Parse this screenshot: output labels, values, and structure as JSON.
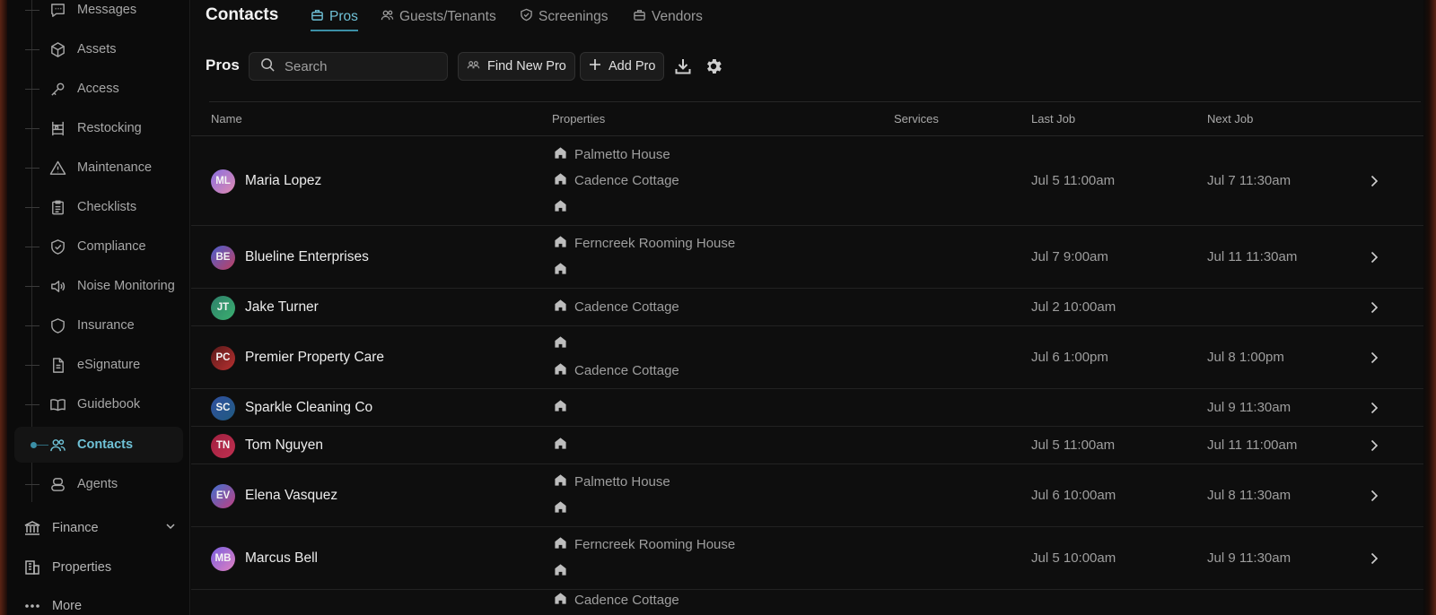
{
  "sidebar": {
    "items": [
      {
        "label": "Messages",
        "icon": "message-icon"
      },
      {
        "label": "Assets",
        "icon": "cube-icon"
      },
      {
        "label": "Access",
        "icon": "key-icon"
      },
      {
        "label": "Restocking",
        "icon": "shelf-icon"
      },
      {
        "label": "Maintenance",
        "icon": "warning-icon"
      },
      {
        "label": "Checklists",
        "icon": "clipboard-icon"
      },
      {
        "label": "Compliance",
        "icon": "shield-check-icon"
      },
      {
        "label": "Noise Monitoring",
        "icon": "speaker-icon"
      },
      {
        "label": "Insurance",
        "icon": "shield-icon"
      },
      {
        "label": "eSignature",
        "icon": "document-icon"
      },
      {
        "label": "Guidebook",
        "icon": "book-icon"
      },
      {
        "label": "Contacts",
        "icon": "users-icon",
        "active": true
      },
      {
        "label": "Agents",
        "icon": "agent-icon"
      }
    ],
    "finance": "Finance",
    "properties": "Properties",
    "more": "More"
  },
  "header": {
    "title": "Contacts",
    "tabs": [
      "Pros",
      "Guests/Tenants",
      "Screenings",
      "Vendors"
    ]
  },
  "toolbar": {
    "section_title": "Pros",
    "search_placeholder": "Search",
    "find_new_pro": "Find New Pro",
    "add_pro": "Add Pro"
  },
  "table": {
    "columns": [
      "Name",
      "Properties",
      "Services",
      "Last Job",
      "Next Job"
    ],
    "rows": [
      {
        "initials": "ML",
        "name": "Maria Lopez",
        "properties": [
          "Palmetto House",
          "Cadence Cottage",
          ""
        ],
        "last_job": "Jul 5 11:00am",
        "next_job": "Jul 7 11:30am"
      },
      {
        "initials": "BE",
        "name": "Blueline Enterprises",
        "properties": [
          "Ferncreek Rooming House",
          ""
        ],
        "last_job": "Jul 7 9:00am",
        "next_job": "Jul 11 11:30am"
      },
      {
        "initials": "JT",
        "name": "Jake Turner",
        "properties": [
          "Cadence Cottage"
        ],
        "last_job": "Jul 2 10:00am",
        "next_job": ""
      },
      {
        "initials": "PC",
        "name": "Premier Property Care",
        "properties": [
          "",
          "Cadence Cottage"
        ],
        "last_job": "Jul 6 1:00pm",
        "next_job": "Jul 8 1:00pm"
      },
      {
        "initials": "SC",
        "name": "Sparkle Cleaning Co",
        "properties": [
          ""
        ],
        "last_job": "",
        "next_job": "Jul 9 11:30am"
      },
      {
        "initials": "TN",
        "name": "Tom Nguyen",
        "properties": [
          ""
        ],
        "last_job": "Jul 5 11:00am",
        "next_job": "Jul 11 11:00am"
      },
      {
        "initials": "EV",
        "name": "Elena Vasquez",
        "properties": [
          "Palmetto House",
          ""
        ],
        "last_job": "Jul 6 10:00am",
        "next_job": "Jul 8 11:30am"
      },
      {
        "initials": "MB",
        "name": "Marcus Bell",
        "properties": [
          "Ferncreek Rooming House",
          ""
        ],
        "last_job": "Jul 5 10:00am",
        "next_job": "Jul 9 11:30am"
      },
      {
        "initials": "",
        "name": "",
        "properties": [
          "Cadence Cottage"
        ],
        "last_job": "",
        "next_job": ""
      }
    ]
  },
  "colors": {
    "accent": "#6fc1d6",
    "avatar_gradients": [
      "#8a6fe0|#e08ab0",
      "#4a5fd0|#c04060",
      "#2f7f6a|#3ab070",
      "#5a1a1a|#b83030",
      "#3050a0|#205a80",
      "#a02040|#c03050",
      "#4070d0|#c04080",
      "#7a60e0|#e080c0",
      "#8a2a20|#c03020"
    ]
  }
}
